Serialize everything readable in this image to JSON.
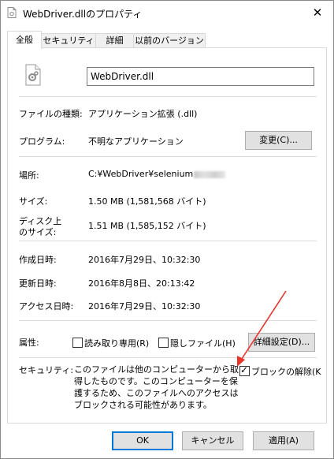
{
  "window": {
    "title": "WebDriver.dllのプロパティ",
    "close_glyph": "✕"
  },
  "tabs": [
    "全般",
    "セキュリティ",
    "詳細",
    "以前のバージョン"
  ],
  "file": {
    "name": "WebDriver.dll",
    "icon": "gear-document-icon"
  },
  "labels": {
    "file_type": "ファイルの種類:",
    "program": "プログラム:",
    "location": "場所:",
    "size": "サイズ:",
    "disk_size_1": "ディスク上",
    "disk_size_2": "のサイズ:",
    "created": "作成日時:",
    "modified": "更新日時:",
    "accessed": "アクセス日時:",
    "attributes": "属性:",
    "security": "セキュリティ:"
  },
  "values": {
    "file_type": "アプリケーション拡張 (.dll)",
    "program": "不明なアプリケーション",
    "location": "C:¥WebDriver¥selenium",
    "size": "1.50 MB (1,581,568 バイト)",
    "disk_size": "1.51 MB (1,585,152 バイト)",
    "created": "2016年7月29日、10:32:30",
    "modified": "2016年8月8日、20:13:42",
    "accessed": "2016年7月29日、10:32:30"
  },
  "buttons": {
    "change": "変更(C)...",
    "advanced": "詳細設定(D)...",
    "ok": "OK",
    "cancel": "キャンセル",
    "apply": "適用(A)"
  },
  "attributes": {
    "readonly_label": "読み取り専用(R)",
    "readonly_checked": false,
    "hidden_label": "隠しファイル(H)",
    "hidden_checked": false
  },
  "security": {
    "message": "このファイルは他のコンピューターから取得したものです。このコンピューターを保護するため、このファイルへのアクセスはブロックされる可能性があります。",
    "unblock_label": "ブロックの解除(K",
    "unblock_checked": true
  },
  "colors": {
    "annotation_arrow": "#e8342b",
    "primary_border": "#0078d7"
  }
}
